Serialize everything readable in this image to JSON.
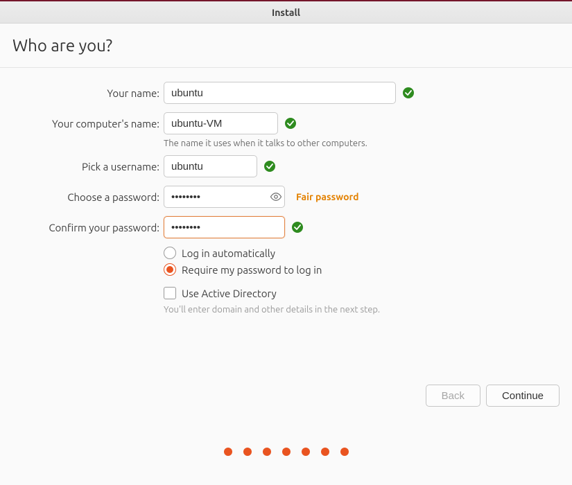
{
  "window": {
    "title": "Install"
  },
  "page": {
    "heading": "Who are you?"
  },
  "labels": {
    "name": "Your name:",
    "host": "Your computer's name:",
    "user": "Pick a username:",
    "pass": "Choose a password:",
    "confirm": "Confirm your password:"
  },
  "values": {
    "name": "ubuntu",
    "host": "ubuntu-VM",
    "user": "ubuntu",
    "pass": "••••••••",
    "confirm": "••••••••"
  },
  "hints": {
    "host": "The name it uses when it talks to other computers.",
    "ad": "You'll enter domain and other details in the next step."
  },
  "strength": "Fair password",
  "options": {
    "auto": "Log in automatically",
    "require": "Require my password to log in",
    "ad": "Use Active Directory"
  },
  "buttons": {
    "back": "Back",
    "continue": "Continue"
  },
  "progress_dots": 7,
  "colors": {
    "accent": "#e95420",
    "success": "#2e8b1f",
    "warning": "#e38100"
  }
}
